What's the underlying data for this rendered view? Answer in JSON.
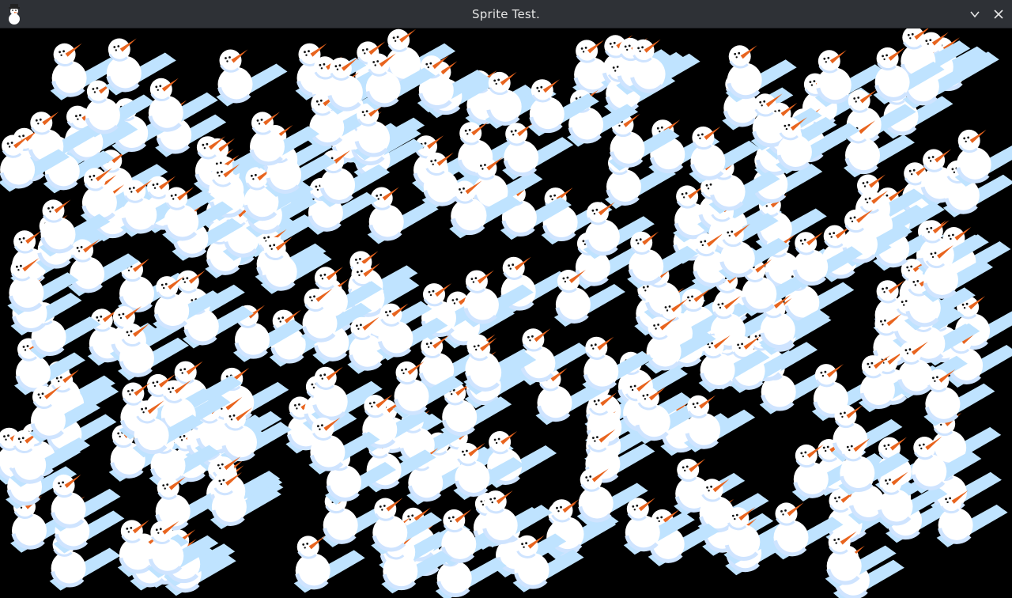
{
  "window": {
    "title": "Sprite Test.",
    "app_icon": "snowman-icon",
    "controls": [
      {
        "name": "minimize",
        "icon": "chevron-down-icon"
      },
      {
        "name": "close",
        "icon": "close-icon"
      }
    ]
  },
  "scene": {
    "background": "#000000",
    "sprite": "snowman",
    "colors": {
      "body": "#ffffff",
      "shading": "#cfe4ff",
      "shadow": "#bfe3ff",
      "eyes": "#111111",
      "nose": "#e8641e"
    }
  }
}
